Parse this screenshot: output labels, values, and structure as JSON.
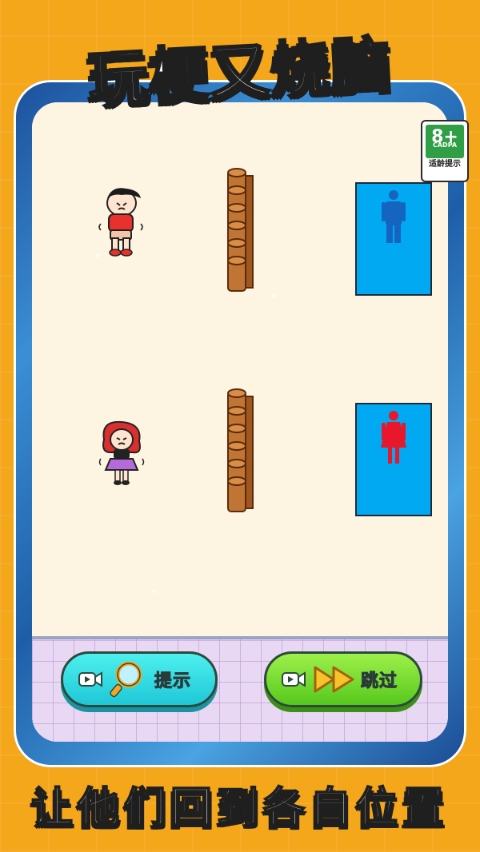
{
  "header": {
    "title": "玩梗又烧脑"
  },
  "age_rating": {
    "age": "8+",
    "org": "CADPA",
    "label": "适龄提示"
  },
  "game": {
    "toilets": [
      {
        "gender": "male",
        "icon": "male-person-icon",
        "color": "#1565c0"
      },
      {
        "gender": "female",
        "icon": "female-person-icon",
        "color": "#e8172c"
      }
    ],
    "characters": [
      {
        "gender": "male",
        "hair_color": "#1b1b1b",
        "shirt_color": "#e8302c"
      },
      {
        "gender": "female",
        "hair_color": "#d92f2f",
        "skirt_color": "#b46ad8"
      }
    ]
  },
  "buttons": {
    "hint": {
      "label": "提示",
      "icon": "magnifier-icon",
      "ad_icon": "video-camera-icon"
    },
    "skip": {
      "label": "跳过",
      "icon": "fast-forward-icon",
      "ad_icon": "video-camera-icon"
    }
  },
  "footer": {
    "slogan": "让他们回到各自位置"
  }
}
